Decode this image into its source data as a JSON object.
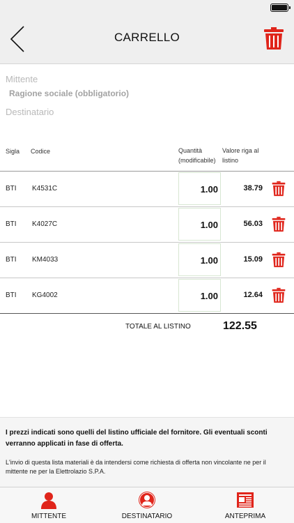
{
  "navbar": {
    "title": "CARRELLO"
  },
  "form": {
    "mittente_placeholder": "Mittente",
    "ragione_sociale_placeholder": "Ragione sociale (obbligatorio)",
    "destinatario_placeholder": "Destinatario"
  },
  "table": {
    "headers": {
      "sigla": "Sigla",
      "codice": "Codice",
      "quantita_line1": "Quantità",
      "quantita_line2": "(modificabile)",
      "valore_line1": "Valore riga al",
      "valore_line2": "listino"
    },
    "rows": [
      {
        "sigla": "BTI",
        "codice": "K4531C",
        "quantita": "1.00",
        "valore": "38.79"
      },
      {
        "sigla": "BTI",
        "codice": "K4027C",
        "quantita": "1.00",
        "valore": "56.03"
      },
      {
        "sigla": "BTI",
        "codice": "KM4033",
        "quantita": "1.00",
        "valore": "15.09"
      },
      {
        "sigla": "BTI",
        "codice": "KG4002",
        "quantita": "1.00",
        "valore": "12.64"
      }
    ]
  },
  "totale": {
    "label": "TOTALE AL LISTINO",
    "value": "122.55"
  },
  "disclaimer": {
    "bold": "I prezzi indicati sono quelli del listino ufficiale del fornitore. Gli eventuali sconti verranno applicati in fase di offerta.",
    "normal": "L'invio di questa lista materiali è da intendersi come richiesta di offerta non vincolante ne per il mittente ne per la Elettrolazio S.P.A."
  },
  "tabbar": {
    "items": [
      {
        "label": "MITTENTE",
        "icon": "person-icon"
      },
      {
        "label": "DESTINATARIO",
        "icon": "person-circle-icon"
      },
      {
        "label": "ANTEPRIMA",
        "icon": "newspaper-icon"
      }
    ]
  },
  "colors": {
    "accent": "#e0251b",
    "navbar_bg": "#efefef",
    "disclaimer_bg": "#f5f5f5"
  }
}
